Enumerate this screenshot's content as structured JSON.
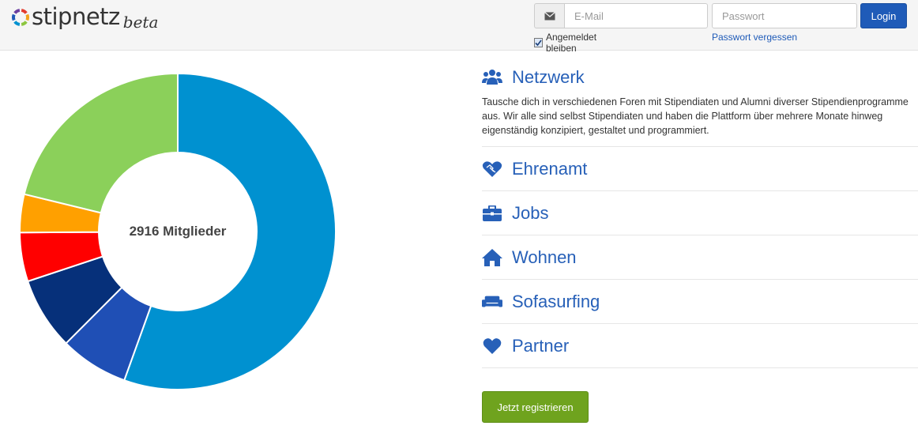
{
  "brand": {
    "name": "stipnetz",
    "suffix": "beta",
    "ring_colors": [
      "#e23b2e",
      "#f2a31b",
      "#8dc63f",
      "#0091d0",
      "#1f5bb8",
      "#6b3fa0"
    ]
  },
  "login": {
    "email_placeholder": "E-Mail",
    "password_placeholder": "Passwort",
    "button_label": "Login",
    "remember_label": "Angemeldet bleiben",
    "remember_checked": true,
    "forgot_label": "Passwort vergessen"
  },
  "chart_data": {
    "type": "pie",
    "center_label": "2916 Mitglieder",
    "series": [
      {
        "value": 55.5,
        "color": "#0091d0"
      },
      {
        "value": 7.0,
        "color": "#1f4fb5"
      },
      {
        "value": 7.4,
        "color": "#06307a"
      },
      {
        "value": 5.0,
        "color": "#ff0000"
      },
      {
        "value": 3.9,
        "color": "#ffa000"
      },
      {
        "value": 21.2,
        "color": "#8bd05a"
      }
    ]
  },
  "features": {
    "netzwerk": {
      "title": "Netzwerk",
      "description": "Tausche dich in verschiedenen Foren mit Stipendiaten und Alumni diverser Stipendienprogramme aus. Wir alle sind selbst Stipendiaten und haben die Plattform über mehrere Monate hinweg eigenständig konzipiert, gestaltet und programmiert."
    },
    "ehrenamt": {
      "title": "Ehrenamt"
    },
    "jobs": {
      "title": "Jobs"
    },
    "wohnen": {
      "title": "Wohnen"
    },
    "sofasurfing": {
      "title": "Sofasurfing"
    },
    "partner": {
      "title": "Partner"
    }
  },
  "register_label": "Jetzt registrieren",
  "colors": {
    "accent": "#2760b8",
    "login_button": "#1f5bb8",
    "register_button": "#6fa31e"
  }
}
